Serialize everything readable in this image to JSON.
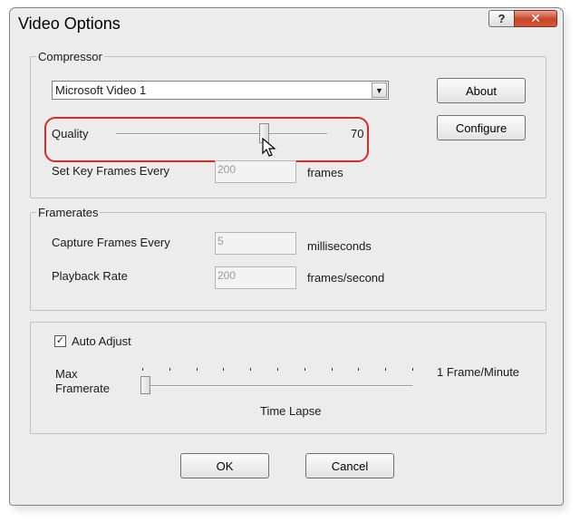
{
  "window": {
    "title": "Video Options",
    "help_label": "?",
    "close_label": "✕"
  },
  "compressor": {
    "legend": "Compressor",
    "selected": "Microsoft Video 1",
    "about_label": "About",
    "configure_label": "Configure",
    "quality_label": "Quality",
    "quality_value": "70",
    "quality_fraction": 0.7,
    "keyframes_label": "Set Key Frames Every",
    "keyframes_value": "200",
    "keyframes_unit": "frames"
  },
  "framerates": {
    "legend": "Framerates",
    "capture_label": "Capture Frames Every",
    "capture_value": "5",
    "capture_unit": "milliseconds",
    "playback_label": "Playback Rate",
    "playback_value": "200",
    "playback_unit": "frames/second"
  },
  "adjust": {
    "auto_adjust_label": "Auto Adjust",
    "auto_adjust_checked": true,
    "max_label_line1": "Max",
    "max_label_line2": "Framerate",
    "min_label": "1 Frame/Minute",
    "caption": "Time Lapse",
    "slider_fraction": 0.0
  },
  "footer": {
    "ok_label": "OK",
    "cancel_label": "Cancel"
  }
}
